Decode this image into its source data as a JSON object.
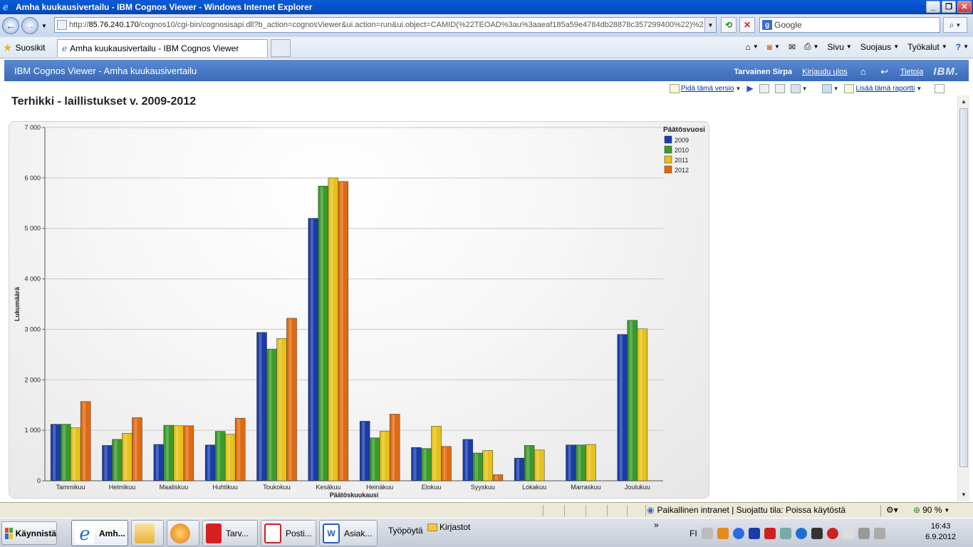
{
  "window": {
    "title": "Amha kuukausivertailu - IBM Cognos Viewer - Windows Internet Explorer"
  },
  "browser": {
    "url_prefix": "http://",
    "url_host": "85.76.240.170",
    "url_rest": "/cognos10/cgi-bin/cognosisapi.dll?b_action=cognosViewer&ui.action=run&ui.object=CAMID(%22TEOAD%3au%3aaeaf185a59e4784db28878c357299400%22)%2",
    "search_placeholder": "Google",
    "favorites_label": "Suosikit",
    "tab_title": "Amha kuukausivertailu - IBM Cognos Viewer",
    "cmd": {
      "page": "Sivu",
      "safety": "Suojaus",
      "tools": "Työkalut"
    }
  },
  "cognos": {
    "header_title": "IBM Cognos Viewer - Amha kuukausivertailu",
    "user": "Tarvainen Sirpa",
    "logout": "Kirjaudu ulos",
    "info": "Tietoja",
    "brand": "IBM.",
    "toolbar": {
      "keep_version": "Pidä tämä versio",
      "add_report": "Lisää tämä raportti"
    }
  },
  "report": {
    "title": "Terhikki - laillistukset v. 2009-2012"
  },
  "chart_data": {
    "type": "bar",
    "title": "",
    "xlabel": "Päätöskuukausi",
    "ylabel": "Lukumäärä",
    "ylim": [
      0,
      7000
    ],
    "yticks": [
      "0",
      "1 000",
      "2 000",
      "3 000",
      "4 000",
      "5 000",
      "6 000",
      "7 000"
    ],
    "ytick_values": [
      0,
      1000,
      2000,
      3000,
      4000,
      5000,
      6000,
      7000
    ],
    "grid": true,
    "legend_title": "Päätösvuosi",
    "legend_position": "top-right",
    "categories": [
      "Tammikuu",
      "Helmikuu",
      "Maaliskuu",
      "Huhtikuu",
      "Toukokuu",
      "Kesäkuu",
      "Heinäkuu",
      "Elokuu",
      "Syyskuu",
      "Lokakuu",
      "Marraskuu",
      "Joulukuu"
    ],
    "series": [
      {
        "name": "2009",
        "color": "#1a3ca8",
        "values": [
          1120,
          700,
          720,
          710,
          2940,
          5200,
          1180,
          660,
          820,
          450,
          710,
          2900
        ]
      },
      {
        "name": "2010",
        "color": "#3a9a2a",
        "values": [
          1120,
          820,
          1100,
          980,
          2610,
          5840,
          850,
          640,
          550,
          700,
          710,
          3180
        ]
      },
      {
        "name": "2011",
        "color": "#e6c21a",
        "values": [
          1050,
          940,
          1090,
          920,
          2820,
          6000,
          980,
          1080,
          600,
          610,
          720,
          3010
        ]
      },
      {
        "name": "2012",
        "color": "#e06a12",
        "values": [
          1570,
          1250,
          1090,
          1240,
          3220,
          5930,
          1320,
          680,
          120,
          null,
          null,
          null
        ]
      }
    ]
  },
  "statusbar": {
    "zone": "Paikallinen intranet | Suojattu tila: Poissa käytöstä",
    "zoom": "90 %"
  },
  "taskbar": {
    "start": "Käynnistä",
    "items": [
      "Amh...",
      "Tarv...",
      "Posti...",
      "Asiak..."
    ],
    "desktop": "Työpöytä",
    "libraries": "Kirjastot",
    "lang": "FI",
    "time": "16:43",
    "date": "6.9.2012"
  }
}
